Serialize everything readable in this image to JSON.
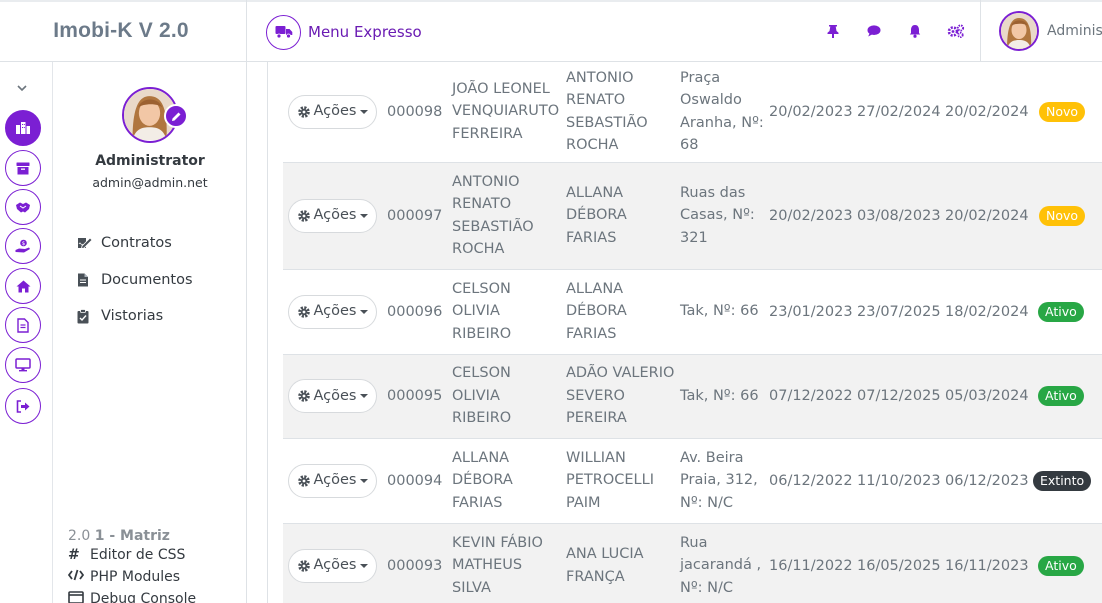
{
  "app": {
    "title": "Imobi-K V 2.0"
  },
  "topbar": {
    "menu_expresso": "Menu Expresso",
    "user_name": "Adminis"
  },
  "profile": {
    "name": "Administrator",
    "email": "admin@admin.net"
  },
  "side_nav": [
    {
      "label": "Contratos",
      "icon": "signature-icon"
    },
    {
      "label": "Documentos",
      "icon": "file-icon"
    },
    {
      "label": "Vistorias",
      "icon": "clipboard-check-icon"
    }
  ],
  "footer": {
    "version": "2.0",
    "matrix": "1 - Matriz",
    "links": [
      {
        "label": "Editor de CSS",
        "icon": "hashtag-icon"
      },
      {
        "label": "PHP Modules",
        "icon": "code-icon"
      },
      {
        "label": "Debug Console",
        "icon": "window-icon"
      }
    ]
  },
  "rail_items": [
    "building-icon",
    "archive-icon",
    "handshake-icon",
    "hand-money-icon",
    "home-icon",
    "file-alt-icon",
    "desktop-icon",
    "sign-out-icon"
  ],
  "action_label": "Ações",
  "rows": [
    {
      "id": "000098",
      "locatario": [
        "JOÃO LEONEL",
        "VENQUIARUTO",
        "FERREIRA"
      ],
      "locador": [
        "ANTONIO",
        "RENATO",
        "SEBASTIÃO",
        "ROCHA"
      ],
      "endereco": [
        "Praça",
        "Oswaldo",
        "Aranha, Nº:",
        "68"
      ],
      "inicio": "20/02/2023",
      "fim": "27/02/2024",
      "cadastro": "20/02/2024",
      "status": "Novo",
      "status_type": "novo"
    },
    {
      "id": "000097",
      "locatario": [
        "ANTONIO",
        "RENATO",
        "SEBASTIÃO",
        "ROCHA"
      ],
      "locador": [
        "ALLANA",
        "DÉBORA",
        "FARIAS"
      ],
      "endereco": [
        "Ruas das",
        "Casas, Nº:",
        "321"
      ],
      "inicio": "20/02/2023",
      "fim": "03/08/2023",
      "cadastro": "20/02/2024",
      "status": "Novo",
      "status_type": "novo"
    },
    {
      "id": "000096",
      "locatario": [
        "CELSON",
        "OLIVIA",
        "RIBEIRO"
      ],
      "locador": [
        "ALLANA",
        "DÉBORA",
        "FARIAS"
      ],
      "endereco": [
        "Tak, Nº: 66"
      ],
      "inicio": "23/01/2023",
      "fim": "23/07/2025",
      "cadastro": "18/02/2024",
      "status": "Ativo",
      "status_type": "ativo"
    },
    {
      "id": "000095",
      "locatario": [
        "CELSON",
        "OLIVIA",
        "RIBEIRO"
      ],
      "locador": [
        "ADÃO VALERIO",
        "SEVERO",
        "PEREIRA"
      ],
      "endereco": [
        "Tak, Nº: 66"
      ],
      "inicio": "07/12/2022",
      "fim": "07/12/2025",
      "cadastro": "05/03/2024",
      "status": "Ativo",
      "status_type": "ativo"
    },
    {
      "id": "000094",
      "locatario": [
        "ALLANA",
        "DÉBORA",
        "FARIAS"
      ],
      "locador": [
        "WILLIAN",
        "PETROCELLI",
        "PAIM"
      ],
      "endereco": [
        "Av. Beira",
        "Praia, 312,",
        "Nº: N/C"
      ],
      "inicio": "06/12/2022",
      "fim": "11/10/2023",
      "cadastro": "06/12/2023",
      "status": "Extinto",
      "status_type": "extinto"
    },
    {
      "id": "000093",
      "locatario": [
        "KEVIN FÁBIO",
        "MATHEUS",
        "SILVA"
      ],
      "locador": [
        "ANA LUCIA",
        "FRANÇA"
      ],
      "endereco": [
        "Rua",
        "jacarandá ,",
        "Nº: N/C"
      ],
      "inicio": "16/11/2022",
      "fim": "16/05/2025",
      "cadastro": "16/11/2023",
      "status": "Ativo",
      "status_type": "ativo"
    }
  ],
  "colors": {
    "accent": "#7b1fd3",
    "novo": "#ffc107",
    "ativo": "#28a745",
    "extinto": "#343a40"
  }
}
